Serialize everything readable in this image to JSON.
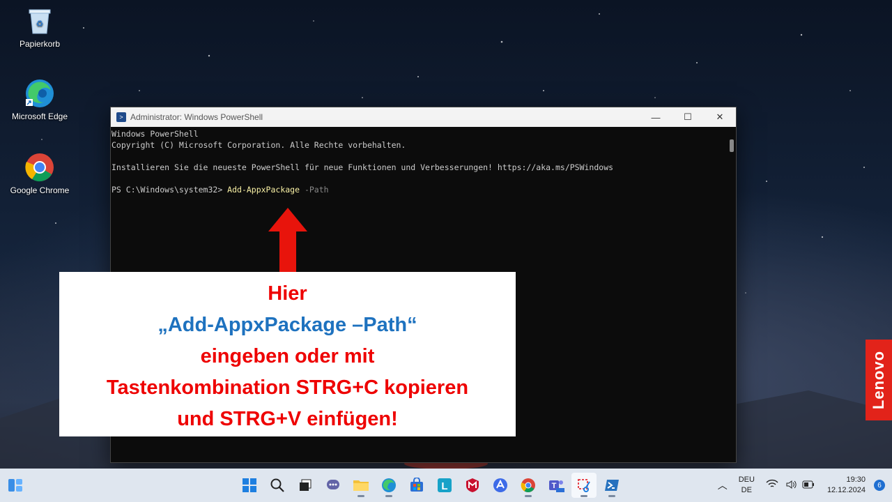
{
  "desktop": {
    "icons": [
      {
        "label": "Papierkorb",
        "icon": "recycle-bin-icon"
      },
      {
        "label": "Microsoft Edge",
        "icon": "edge-icon"
      },
      {
        "label": "Google Chrome",
        "icon": "chrome-icon"
      }
    ]
  },
  "window": {
    "title": "Administrator: Windows PowerShell",
    "minimize": "—",
    "maximize": "☐",
    "close": "✕",
    "lines": [
      "Windows PowerShell",
      "Copyright (C) Microsoft Corporation. Alle Rechte vorbehalten.",
      "",
      "Installieren Sie die neueste PowerShell für neue Funktionen und Verbesserungen! https://aka.ms/PSWindows",
      ""
    ],
    "prompt": "PS C:\\Windows\\system32> ",
    "command": "Add-AppxPackage",
    "parameter": " -Path"
  },
  "callout": {
    "line1": "Hier",
    "line2": "„Add-AppxPackage –Path“",
    "line3": "eingeben oder mit",
    "line4": "Tastenkombination STRG+C kopieren",
    "line5": "und STRG+V einfügen!",
    "colors": {
      "red": "#e00000",
      "blue": "#1e72bf"
    }
  },
  "brand": {
    "label": "Lenovo"
  },
  "taskbar": {
    "apps": [
      "start-icon",
      "search-icon",
      "task-view-icon",
      "teams-chat-icon",
      "file-explorer-icon",
      "edge-icon",
      "store-icon",
      "l-app-icon",
      "mcafee-icon",
      "arc-icon",
      "chrome-icon",
      "teams-icon",
      "snipping-tool-icon",
      "powershell-icon"
    ],
    "language_top": "DEU",
    "language_bottom": "DE",
    "time": "19:30",
    "date": "12.12.2024",
    "notifications": "6"
  }
}
